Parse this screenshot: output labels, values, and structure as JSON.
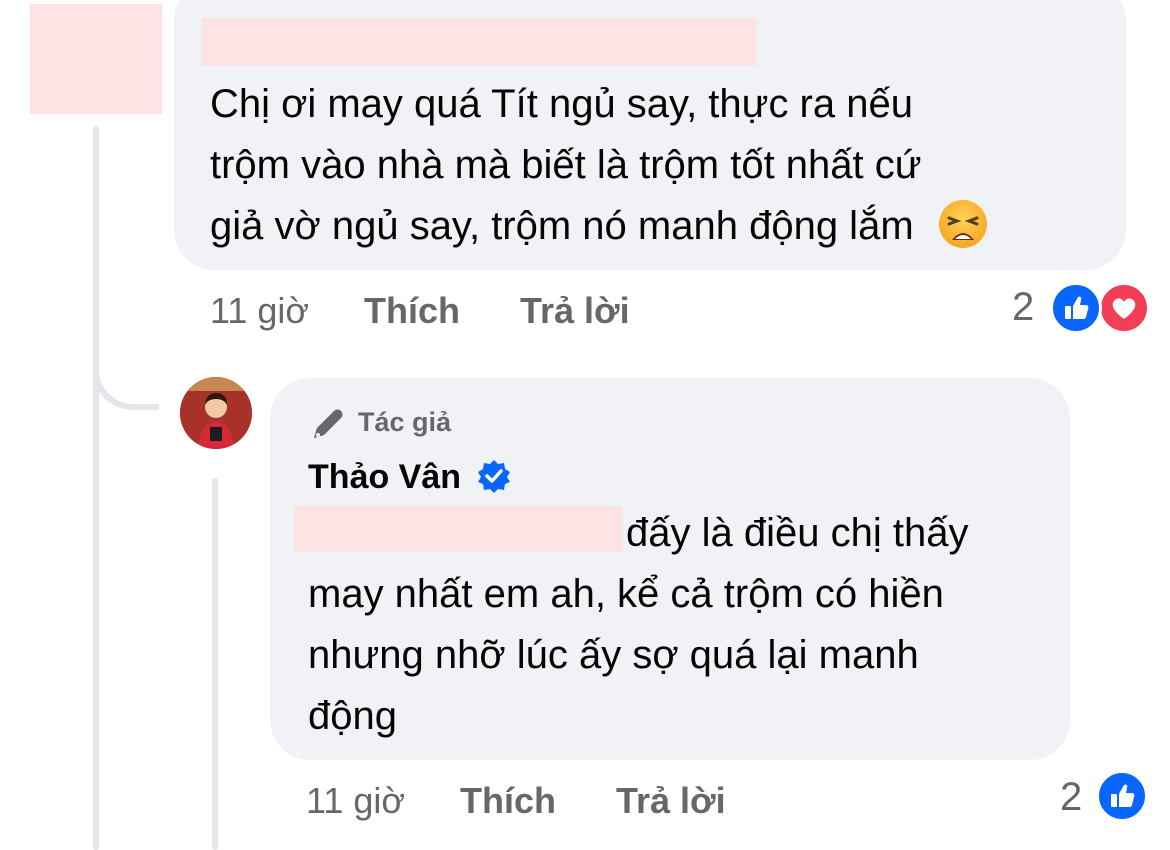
{
  "comment1": {
    "text_lines": [
      "Chị ơi may quá Tít ngủ say, thực ra nếu",
      "trộm vào nhà mà biết là trộm tốt nhất cứ",
      "giả vờ ngủ say, trộm nó manh động lắm"
    ],
    "emoji": "weary-face-emoji",
    "time": "11 giờ",
    "like_label": "Thích",
    "reply_label": "Trả lời",
    "reaction_count": "2",
    "reactions": [
      "like-icon",
      "heart-icon"
    ]
  },
  "reply1": {
    "badge_label": "Tác giả",
    "badge_icon": "pen-icon",
    "author": "Thảo Vân",
    "verified_icon": "verified-badge-icon",
    "text_first_line": "đấy là điều chị thấy",
    "text_lines": [
      "may nhất em ah, kể cả trộm có hiền",
      "nhưng nhỡ lúc ấy sợ quá lại manh",
      "động"
    ],
    "time": "11 giờ",
    "like_label": "Thích",
    "reply_label": "Trả lời",
    "reaction_count": "2",
    "reactions": [
      "like-icon"
    ]
  },
  "colors": {
    "bubble": "#f0f2f5",
    "meta_text": "#65676b",
    "like_blue": "#0866ff",
    "love_red": "#f33e58",
    "redaction": "#fde3e3"
  }
}
